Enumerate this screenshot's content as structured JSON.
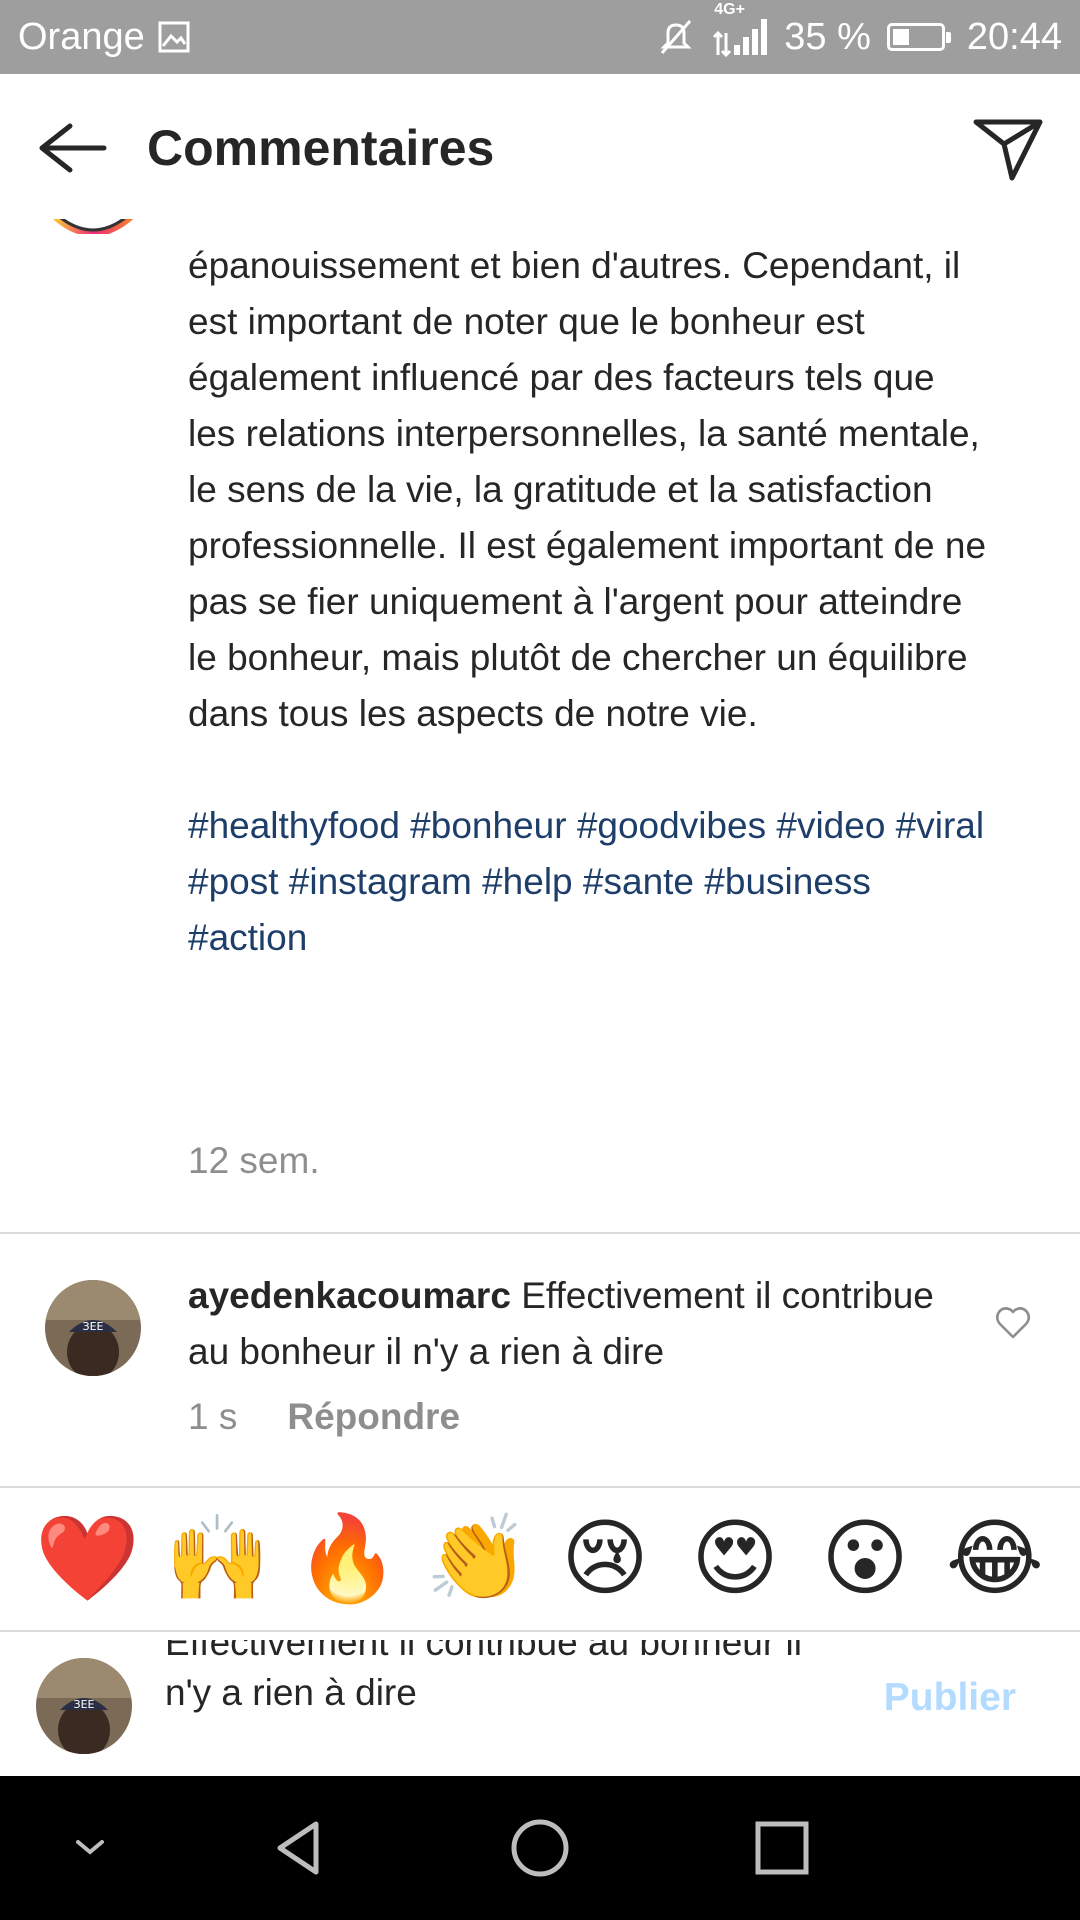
{
  "status_bar": {
    "carrier": "Orange",
    "network": "4G+",
    "battery": "35 %",
    "battery_level": 0.35,
    "time": "20:44"
  },
  "header": {
    "title": "Commentaires",
    "back_icon": "arrow-left-icon",
    "share_icon": "paper-plane-icon"
  },
  "caption": {
    "paragraph": "épanouissement et bien d'autres. Cependant, il est important de noter que le bonheur est également influencé par des facteurs tels que les relations interpersonnelles, la santé mentale, le sens de la vie, la gratitude et la satisfaction professionnelle. Il est également important de ne pas se fier uniquement à l'argent pour atteindre le bonheur, mais plutôt de chercher un équilibre dans tous les aspects de notre vie.",
    "hashtags": "#healthyfood #bonheur #goodvibes #video #viral #post #instagram #help #sante #business #action",
    "time": "12 sem.",
    "hashtag_color": "#1e3e6a"
  },
  "comment": {
    "username": "ayedenkacoumarc",
    "text": "Effectivement il contribue au bonheur il n'y a rien à dire",
    "time": "1 s",
    "reply_label": "Répondre"
  },
  "emoji_bar": {
    "items": [
      "❤️",
      "🙌",
      "🔥",
      "👏",
      "😢",
      "😍",
      "😮",
      "😂"
    ]
  },
  "composer": {
    "value": "Effectivement il contribue au bonheur il n'y a rien à dire",
    "publish_label": "Publier",
    "publish_color": "#b3dbff"
  }
}
